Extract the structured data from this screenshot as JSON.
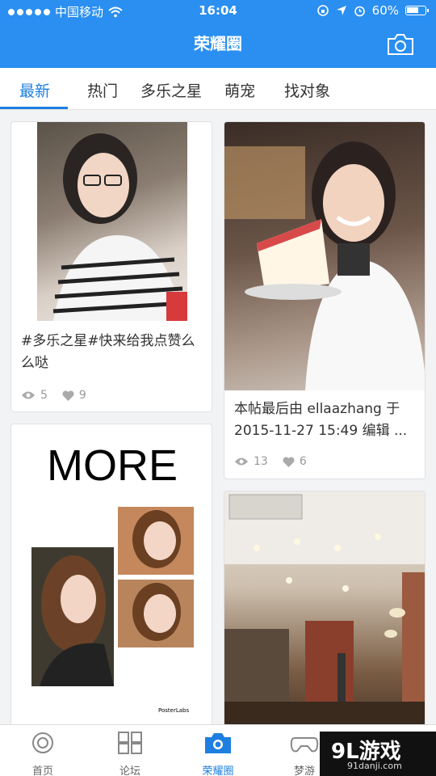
{
  "status_bar": {
    "carrier": "中国移动",
    "time": "16:04",
    "battery": "60%"
  },
  "header": {
    "title": "荣耀圈"
  },
  "tabs": [
    {
      "label": "最新"
    },
    {
      "label": "热门"
    },
    {
      "label": "多乐之星"
    },
    {
      "label": "萌宠"
    },
    {
      "label": "找对象"
    }
  ],
  "posts": [
    {
      "text": "#多乐之星#快来给我点赞么么哒",
      "views": "5",
      "likes": "9"
    },
    {
      "text": "本帖最后由 ellaazhang 于 2015-11-27 15:49 编辑 ...",
      "views": "13",
      "likes": "6"
    },
    {
      "image_title": "MORE",
      "image_footer": "PosterLabs"
    }
  ],
  "bottom_nav": [
    {
      "label": "首页"
    },
    {
      "label": "论坛"
    },
    {
      "label": "荣耀圈"
    },
    {
      "label": "梦游"
    }
  ],
  "watermark": {
    "main": "9L游戏",
    "sub": "91danji.com"
  },
  "colors": {
    "brand_blue": "#2a8ff0",
    "tab_active": "#1e7fe0"
  }
}
